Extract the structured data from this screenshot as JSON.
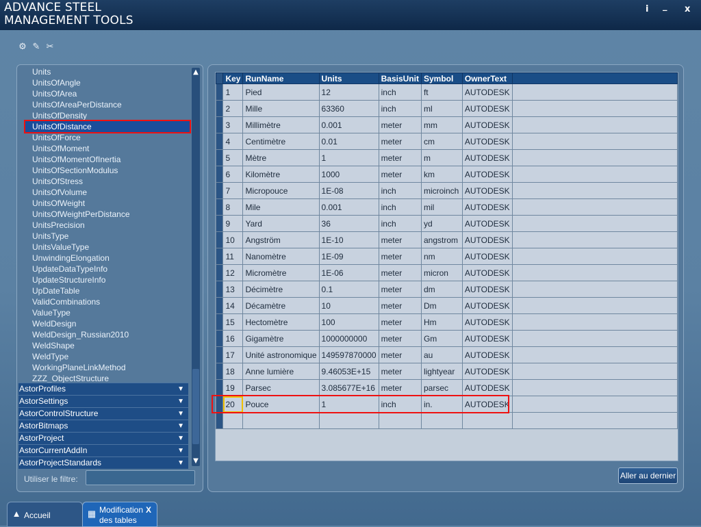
{
  "app": {
    "title_line1": "ADVANCE STEEL",
    "title_line2": "MANAGEMENT TOOLS",
    "info": "i",
    "minimize": "_",
    "close": "x"
  },
  "toolbar": {
    "icons": [
      "gear-list-icon",
      "edit-list-icon",
      "tools-icon"
    ]
  },
  "tree": {
    "items": [
      "Units",
      "UnitsOfAngle",
      "UnitsOfArea",
      "UnitsOfAreaPerDistance",
      "UnitsOfDensity",
      "UnitsOfDistance",
      "UnitsOfForce",
      "UnitsOfMoment",
      "UnitsOfMomentOfInertia",
      "UnitsOfSectionModulus",
      "UnitsOfStress",
      "UnitsOfVolume",
      "UnitsOfWeight",
      "UnitsOfWeightPerDistance",
      "UnitsPrecision",
      "UnitsType",
      "UnitsValueType",
      "UnwindingElongation",
      "UpdateDataTypeInfo",
      "UpdateStructureInfo",
      "UpDateTable",
      "ValidCombinations",
      "ValueType",
      "WeldDesign",
      "WeldDesign_Russian2010",
      "WeldShape",
      "WeldType",
      "WorkingPlaneLinkMethod",
      "ZZZ_ObjectStructure"
    ],
    "selected": "UnitsOfDistance",
    "categories": [
      "AstorProfiles",
      "AstorSettings",
      "AstorControlStructure",
      "AstorBitmaps",
      "AstorProject",
      "AstorCurrentAddIn",
      "AstorProjectStandards"
    ]
  },
  "filter": {
    "label": "Utiliser le filtre:",
    "value": ""
  },
  "grid": {
    "columns": [
      "Key",
      "RunName",
      "Units",
      "BasisUnit",
      "Symbol",
      "OwnerText"
    ],
    "rows": [
      [
        "1",
        "Pied",
        "12",
        "inch",
        "ft",
        "AUTODESK"
      ],
      [
        "2",
        "Mille",
        "63360",
        "inch",
        "ml",
        "AUTODESK"
      ],
      [
        "3",
        "Millimètre",
        "0.001",
        "meter",
        "mm",
        "AUTODESK"
      ],
      [
        "4",
        "Centimètre",
        "0.01",
        "meter",
        "cm",
        "AUTODESK"
      ],
      [
        "5",
        "Mètre",
        "1",
        "meter",
        "m",
        "AUTODESK"
      ],
      [
        "6",
        "Kilomètre",
        "1000",
        "meter",
        "km",
        "AUTODESK"
      ],
      [
        "7",
        "Micropouce",
        "1E-08",
        "inch",
        "microinch",
        "AUTODESK"
      ],
      [
        "8",
        "Mile",
        "0.001",
        "inch",
        "mil",
        "AUTODESK"
      ],
      [
        "9",
        "Yard",
        "36",
        "inch",
        "yd",
        "AUTODESK"
      ],
      [
        "10",
        "Angström",
        "1E-10",
        "meter",
        "angstrom",
        "AUTODESK"
      ],
      [
        "11",
        "Nanomètre",
        "1E-09",
        "meter",
        "nm",
        "AUTODESK"
      ],
      [
        "12",
        "Micromètre",
        "1E-06",
        "meter",
        "micron",
        "AUTODESK"
      ],
      [
        "13",
        "Décimètre",
        "0.1",
        "meter",
        "dm",
        "AUTODESK"
      ],
      [
        "14",
        "Décamètre",
        "10",
        "meter",
        "Dm",
        "AUTODESK"
      ],
      [
        "15",
        "Hectomètre",
        "100",
        "meter",
        "Hm",
        "AUTODESK"
      ],
      [
        "16",
        "Gigamètre",
        "1000000000",
        "meter",
        "Gm",
        "AUTODESK"
      ],
      [
        "17",
        "Unité astronomique",
        "149597870000",
        "meter",
        "au",
        "AUTODESK"
      ],
      [
        "18",
        "Anne lumière",
        "9.46053E+15",
        "meter",
        "lightyear",
        "AUTODESK"
      ],
      [
        "19",
        "Parsec",
        "3.085677E+16",
        "meter",
        "parsec",
        "AUTODESK"
      ],
      [
        "20",
        "Pouce",
        "1",
        "inch",
        "in.",
        "AUTODESK"
      ]
    ]
  },
  "buttons": {
    "go_last": "Aller au dernier"
  },
  "tabs": {
    "home": "Accueil",
    "modif_line1": "Modification",
    "modif_line2": "des tables",
    "modif_close": "X"
  },
  "colors": {
    "selection": "#1b4e9b",
    "highlight_outline": "#ee1111",
    "key_focus": "#f0c000"
  }
}
